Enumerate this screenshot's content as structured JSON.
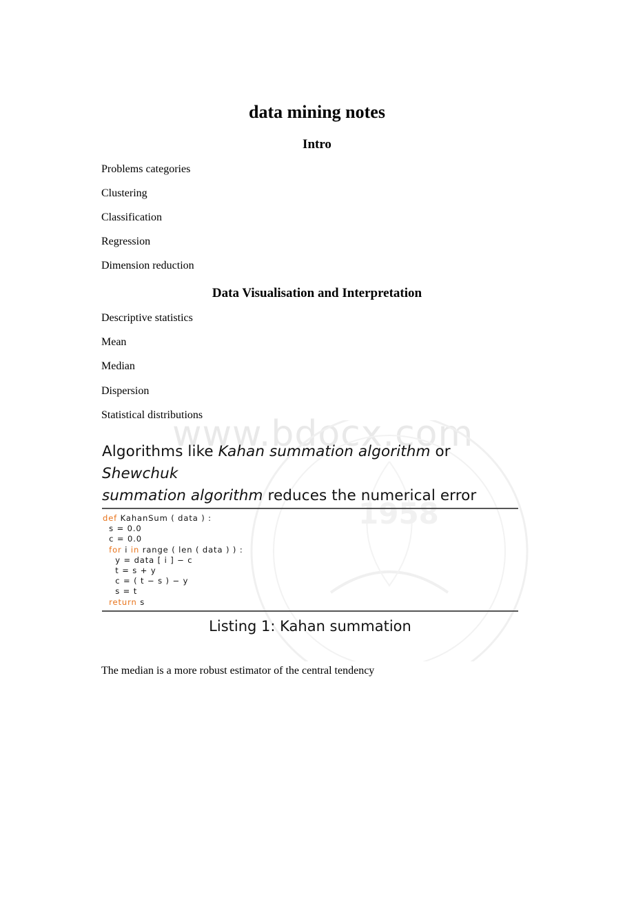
{
  "document": {
    "title": "data mining notes",
    "sections": [
      {
        "heading": "Intro",
        "items": [
          "Problems categories",
          "Clustering",
          "Classification",
          "Regression",
          "Dimension reduction"
        ]
      },
      {
        "heading": "Data Visualisation and Interpretation",
        "items": [
          "Descriptive statistics",
          "Mean",
          "Median",
          "Dispersion",
          "Statistical distributions"
        ]
      }
    ],
    "algorithms_sentence": {
      "part1": "Algorithms like ",
      "italic1": "Kahan summation algorithm",
      "part2": " or ",
      "italic2": "Shewchuk",
      "italic3": "summation algorithm",
      "part3": " reduces the numerical error"
    },
    "listing": {
      "lines": [
        {
          "indent": "",
          "kw": "def",
          "rest": " KahanSum ( data ) :"
        },
        {
          "indent": "  ",
          "kw": "",
          "rest": "s = 0.0"
        },
        {
          "indent": "  ",
          "kw": "",
          "rest": "c = 0.0"
        },
        {
          "indent": "  ",
          "kw": "for",
          "rest": " i ",
          "kw2": "in",
          "rest2": " range ( len ( data ) ) :"
        },
        {
          "indent": "    ",
          "kw": "",
          "rest": "y = data [ i ] − c"
        },
        {
          "indent": "    ",
          "kw": "",
          "rest": "t = s + y"
        },
        {
          "indent": "    ",
          "kw": "",
          "rest": "c = ( t − s ) − y"
        },
        {
          "indent": "    ",
          "kw": "",
          "rest": "s = t"
        },
        {
          "indent": "  ",
          "kw": "return",
          "rest": " s"
        }
      ],
      "caption": "Listing 1: Kahan summation",
      "keyword_color": "#e8731a"
    },
    "closing_sentence": "The median is a more robust estimator of the central tendency"
  },
  "watermark": {
    "text": "www.bdocx.com",
    "emblem_year": "1958"
  }
}
